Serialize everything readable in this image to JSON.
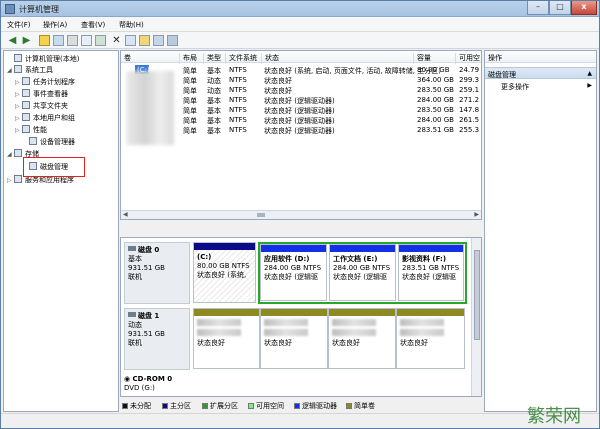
{
  "window": {
    "title": "计算机管理"
  },
  "titlebar": {
    "min": "–",
    "max": "□",
    "close": "x"
  },
  "menubar": [
    "文件(F)",
    "操作(A)",
    "查看(V)",
    "帮助(H)"
  ],
  "tree": [
    {
      "label": "计算机管理(本地)",
      "icon": "computer-icon",
      "expander": ""
    },
    {
      "label": "系统工具",
      "icon": "tools-icon",
      "expander": "◢"
    },
    {
      "label": "任务计划程序",
      "icon": "clock-icon",
      "expander": "▷"
    },
    {
      "label": "事件查看器",
      "icon": "event-viewer-icon",
      "expander": "▷"
    },
    {
      "label": "共享文件夹",
      "icon": "shared-folder-icon",
      "expander": "▷"
    },
    {
      "label": "本地用户和组",
      "icon": "users-icon",
      "expander": "▷"
    },
    {
      "label": "性能",
      "icon": "performance-icon",
      "expander": "▷"
    },
    {
      "label": "设备管理器",
      "icon": "device-manager-icon",
      "expander": ""
    },
    {
      "label": "存储",
      "icon": "storage-icon",
      "expander": "◢"
    },
    {
      "label": "磁盘管理",
      "icon": "disk-management-icon",
      "expander": ""
    },
    {
      "label": "服务和应用程序",
      "icon": "services-icon",
      "expander": "▷"
    }
  ],
  "volume_list": {
    "headers": [
      "卷",
      "布局",
      "类型",
      "文件系统",
      "状态",
      "容量",
      "可用空"
    ],
    "rows": [
      {
        "vol": "(C:)",
        "layout": "简单",
        "type": "基本",
        "fs": "NTFS",
        "status": "状态良好 (系统, 启动, 页面文件, 活动, 故障转储, 主分区)",
        "cap": "80.00 GB",
        "free": "24.79"
      },
      {
        "vol": "",
        "layout": "简单",
        "type": "动态",
        "fs": "NTFS",
        "status": "状态良好",
        "cap": "364.00 GB",
        "free": "299.3"
      },
      {
        "vol": "",
        "layout": "简单",
        "type": "动态",
        "fs": "NTFS",
        "status": "状态良好",
        "cap": "283.50 GB",
        "free": "259.1"
      },
      {
        "vol": "",
        "layout": "简单",
        "type": "基本",
        "fs": "NTFS",
        "status": "状态良好 (逻辑驱动器)",
        "cap": "284.00 GB",
        "free": "271.2"
      },
      {
        "vol": "",
        "layout": "简单",
        "type": "基本",
        "fs": "NTFS",
        "status": "状态良好 (逻辑驱动器)",
        "cap": "283.50 GB",
        "free": "147.8"
      },
      {
        "vol": "",
        "layout": "简单",
        "type": "基本",
        "fs": "NTFS",
        "status": "状态良好 (逻辑驱动器)",
        "cap": "284.00 GB",
        "free": "261.5"
      },
      {
        "vol": "",
        "layout": "简单",
        "type": "基本",
        "fs": "NTFS",
        "status": "状态良好 (逻辑驱动器)",
        "cap": "283.51 GB",
        "free": "255.3"
      }
    ]
  },
  "disk0": {
    "name": "磁盘 0",
    "type": "基本",
    "size": "931.51 GB",
    "state": "联机",
    "partitions": [
      {
        "name": "(C:)",
        "size": "80.00 GB NTFS",
        "status": "状态良好 (系统,",
        "bar": "#0b0b8a"
      },
      {
        "name": "应用软件 (D:)",
        "size": "284.00 GB NTFS",
        "status": "状态良好 (逻辑驱",
        "bar": "#1430e6"
      },
      {
        "name": "工作文档 (E:)",
        "size": "284.00 GB NTFS",
        "status": "状态良好 (逻辑驱",
        "bar": "#1430e6"
      },
      {
        "name": "影视资料 (F:)",
        "size": "283.51 GB NTFS",
        "status": "状态良好 (逻辑驱",
        "bar": "#1430e6"
      }
    ]
  },
  "disk1": {
    "name": "磁盘 1",
    "type": "动态",
    "size": "931.51 GB",
    "state": "联机",
    "partitions": [
      {
        "status": "状态良好",
        "bar": "#8c8a21"
      },
      {
        "status": "状态良好",
        "bar": "#8c8a21"
      },
      {
        "status": "状态良好",
        "bar": "#8c8a21"
      },
      {
        "status": "状态良好",
        "bar": "#8c8a21"
      }
    ]
  },
  "cdrom": {
    "name": "CD-ROM 0",
    "drive": "DVD (G:)"
  },
  "legend": [
    {
      "label": "未分配",
      "color": "#111111"
    },
    {
      "label": "主分区",
      "color": "#0b0b8a"
    },
    {
      "label": "扩展分区",
      "color": "#2f9a2f"
    },
    {
      "label": "可用空间",
      "color": "#7cf07c"
    },
    {
      "label": "逻辑驱动器",
      "color": "#1430e6"
    },
    {
      "label": "简单卷",
      "color": "#8c8a21"
    }
  ],
  "actions": {
    "header": "操作",
    "section": "磁盘管理",
    "more": "更多操作"
  },
  "watermark": "繁荣网"
}
